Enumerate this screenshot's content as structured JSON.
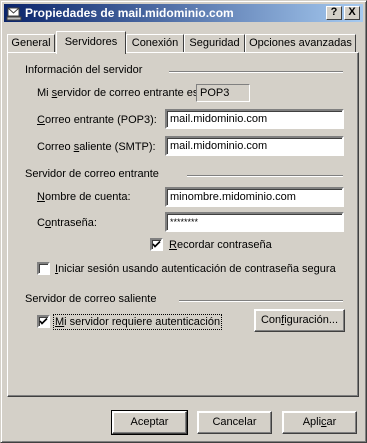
{
  "window": {
    "title": "Propiedades de mail.midominio.com"
  },
  "titlebar_buttons": {
    "help": "?",
    "close": "X"
  },
  "tabs": [
    {
      "label": "General"
    },
    {
      "label": "Servidores"
    },
    {
      "label": "Conexión"
    },
    {
      "label": "Seguridad"
    },
    {
      "label": "Opciones avanzadas"
    }
  ],
  "active_tab": "Servidores",
  "server_info": {
    "heading": "Información del servidor",
    "incoming_type_label_pre": "Mi ",
    "incoming_type_label_u": "s",
    "incoming_type_label_post": "ervidor de correo entrante es",
    "incoming_type_value": "POP3",
    "incoming_label_u": "C",
    "incoming_label_rest": "orreo entrante (POP3):",
    "incoming_value": "mail.midominio.com",
    "outgoing_label_pre": "Correo ",
    "outgoing_label_u": "s",
    "outgoing_label_post": "aliente (SMTP):",
    "outgoing_value": "mail.midominio.com"
  },
  "incoming_server": {
    "heading": "Servidor de correo entrante",
    "account_label_u": "N",
    "account_label_rest": "ombre de cuenta:",
    "account_value": "minombre.midominio.com",
    "password_label_pre": "C",
    "password_label_u": "o",
    "password_label_post": "ntraseña:",
    "password_value": "********",
    "remember_label_u": "R",
    "remember_label_rest": "ecordar contraseña",
    "remember_checked": true,
    "spa_label_u": "I",
    "spa_label_rest": "niciar sesión usando autenticación de contraseña segura",
    "spa_checked": false
  },
  "outgoing_server": {
    "heading": "Servidor de correo saliente",
    "auth_label_u": "M",
    "auth_label_rest": "i servidor requiere autenticación",
    "auth_checked": true,
    "config_button_pre": "Con",
    "config_button_u": "f",
    "config_button_post": "iguración..."
  },
  "footer": {
    "ok": "Aceptar",
    "cancel": "Cancelar",
    "apply_pre": "Apli",
    "apply_u": "c",
    "apply_post": "ar"
  }
}
